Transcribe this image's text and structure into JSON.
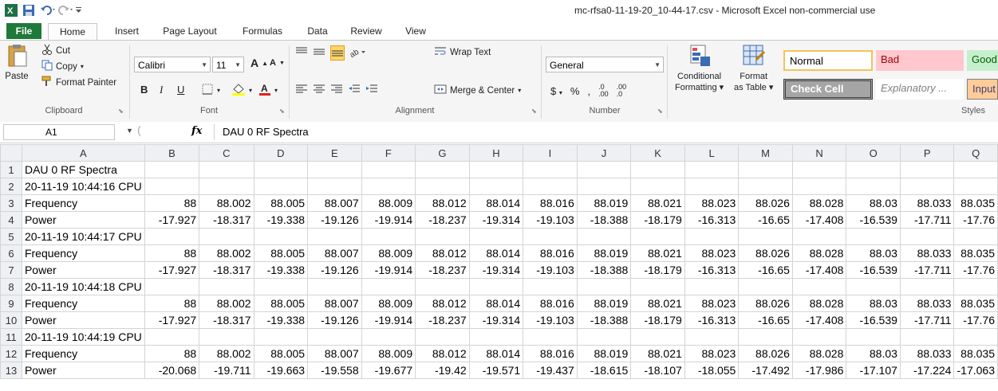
{
  "title_bar": {
    "title": "mc-rfsa0-11-19-20_10-44-17.csv  -  Microsoft Excel non-commercial use"
  },
  "ribbon_tabs": [
    "File",
    "Home",
    "Insert",
    "Page Layout",
    "Formulas",
    "Data",
    "Review",
    "View"
  ],
  "clipboard": {
    "paste": "Paste",
    "cut": "Cut",
    "copy": "Copy",
    "format_painter": "Format Painter",
    "group_label": "Clipboard"
  },
  "font": {
    "name": "Calibri",
    "size": "11",
    "bold": "B",
    "italic": "I",
    "underline": "U",
    "grow": "A",
    "shrink": "A",
    "group_label": "Font"
  },
  "alignment": {
    "wrap_text": "Wrap Text",
    "merge_center": "Merge & Center",
    "group_label": "Alignment"
  },
  "number": {
    "format": "General",
    "currency": "$",
    "percent": "%",
    "comma": ",",
    "inc_decimal": ".00",
    "dec_decimal": ".0",
    "group_label": "Number"
  },
  "styles": {
    "conditional_formatting": "Conditional",
    "conditional_formatting_2": "Formatting",
    "format_as_table": "Format",
    "format_as_table_2": "as Table",
    "normal": "Normal",
    "bad": "Bad",
    "good": "Good",
    "check_cell": "Check Cell",
    "explanatory": "Explanatory ...",
    "input": "Input",
    "group_label": "Styles"
  },
  "formula_bar": {
    "name_box": "A1",
    "fx": "fx",
    "formula": "DAU 0 RF Spectra"
  },
  "columns": [
    "A",
    "B",
    "C",
    "D",
    "E",
    "F",
    "G",
    "H",
    "I",
    "J",
    "K",
    "L",
    "M",
    "N",
    "O",
    "P",
    "Q"
  ],
  "rows": [
    {
      "n": "1",
      "cells": [
        "DAU 0 RF Spectra"
      ]
    },
    {
      "n": "2",
      "cells": [
        "20-11-19 10:44:16 CPU"
      ]
    },
    {
      "n": "3",
      "cells": [
        "Frequency",
        "88",
        "88.002",
        "88.005",
        "88.007",
        "88.009",
        "88.012",
        "88.014",
        "88.016",
        "88.019",
        "88.021",
        "88.023",
        "88.026",
        "88.028",
        "88.03",
        "88.033",
        "88.035"
      ]
    },
    {
      "n": "4",
      "cells": [
        "Power",
        "-17.927",
        "-18.317",
        "-19.338",
        "-19.126",
        "-19.914",
        "-18.237",
        "-19.314",
        "-19.103",
        "-18.388",
        "-18.179",
        "-16.313",
        "-16.65",
        "-17.408",
        "-16.539",
        "-17.711",
        "-17.76"
      ]
    },
    {
      "n": "5",
      "cells": [
        "20-11-19 10:44:17 CPU"
      ]
    },
    {
      "n": "6",
      "cells": [
        "Frequency",
        "88",
        "88.002",
        "88.005",
        "88.007",
        "88.009",
        "88.012",
        "88.014",
        "88.016",
        "88.019",
        "88.021",
        "88.023",
        "88.026",
        "88.028",
        "88.03",
        "88.033",
        "88.035"
      ]
    },
    {
      "n": "7",
      "cells": [
        "Power",
        "-17.927",
        "-18.317",
        "-19.338",
        "-19.126",
        "-19.914",
        "-18.237",
        "-19.314",
        "-19.103",
        "-18.388",
        "-18.179",
        "-16.313",
        "-16.65",
        "-17.408",
        "-16.539",
        "-17.711",
        "-17.76"
      ]
    },
    {
      "n": "8",
      "cells": [
        "20-11-19 10:44:18 CPU"
      ]
    },
    {
      "n": "9",
      "cells": [
        "Frequency",
        "88",
        "88.002",
        "88.005",
        "88.007",
        "88.009",
        "88.012",
        "88.014",
        "88.016",
        "88.019",
        "88.021",
        "88.023",
        "88.026",
        "88.028",
        "88.03",
        "88.033",
        "88.035"
      ]
    },
    {
      "n": "10",
      "cells": [
        "Power",
        "-17.927",
        "-18.317",
        "-19.338",
        "-19.126",
        "-19.914",
        "-18.237",
        "-19.314",
        "-19.103",
        "-18.388",
        "-18.179",
        "-16.313",
        "-16.65",
        "-17.408",
        "-16.539",
        "-17.711",
        "-17.76"
      ]
    },
    {
      "n": "11",
      "cells": [
        "20-11-19 10:44:19 CPU"
      ]
    },
    {
      "n": "12",
      "cells": [
        "Frequency",
        "88",
        "88.002",
        "88.005",
        "88.007",
        "88.009",
        "88.012",
        "88.014",
        "88.016",
        "88.019",
        "88.021",
        "88.023",
        "88.026",
        "88.028",
        "88.03",
        "88.033",
        "88.035"
      ]
    },
    {
      "n": "13",
      "cells": [
        "Power",
        "-20.068",
        "-19.711",
        "-19.663",
        "-19.558",
        "-19.677",
        "-19.42",
        "-19.571",
        "-19.437",
        "-18.615",
        "-18.107",
        "-18.055",
        "-17.492",
        "-17.986",
        "-17.107",
        "-17.224",
        "-17.063"
      ]
    }
  ]
}
